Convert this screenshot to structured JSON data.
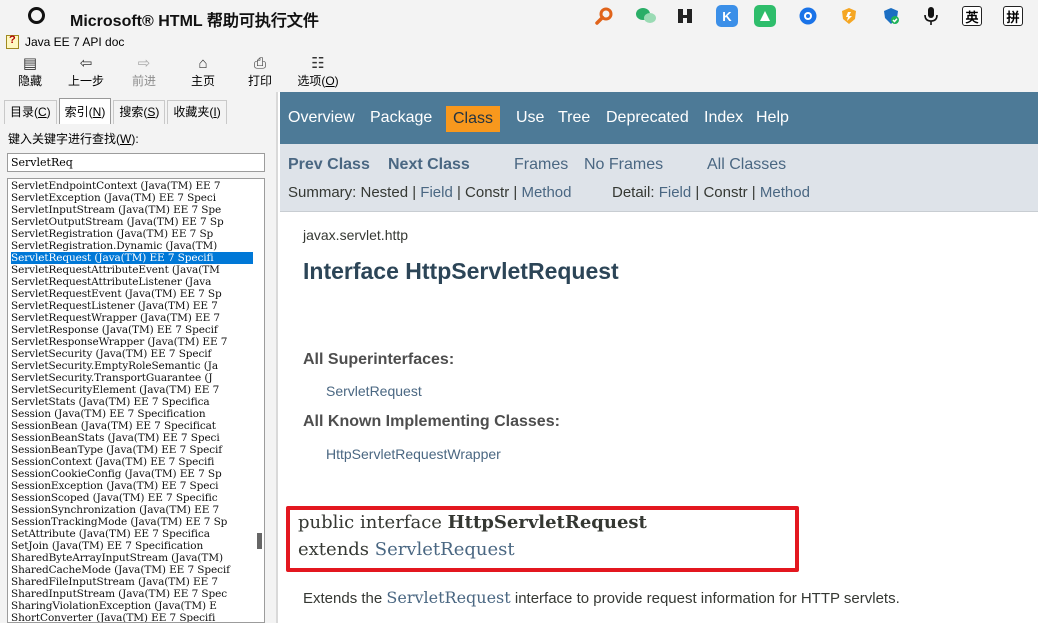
{
  "system_bar": {
    "title": "Microsoft® HTML 帮助可执行文件",
    "tray": {
      "ime_lang": "英",
      "ime_mode": "拼"
    }
  },
  "window": {
    "title": "Java EE 7 API doc"
  },
  "toolbar": {
    "hide_label": "隐藏",
    "back_label": "上一步",
    "forward_label": "前进",
    "home_label": "主页",
    "print_label": "打印",
    "options_label": "选项(",
    "options_key": "O",
    "options_tail": ")"
  },
  "nav": {
    "tabs": [
      {
        "label": "目录(",
        "key": "C",
        "tail": ")"
      },
      {
        "label": "索引(",
        "key": "N",
        "tail": ")"
      },
      {
        "label": "搜索(",
        "key": "S",
        "tail": ")"
      },
      {
        "label": "收藏夹(",
        "key": "I",
        "tail": ")"
      }
    ],
    "keyword_label": "键入关键字进行查找(",
    "keyword_key": "W",
    "keyword_tail": "):",
    "keyword_value": "ServletReq",
    "list_items": [
      "ServletEndpointContext (Java(TM) EE 7",
      "ServletException (Java(TM) EE 7 Speci",
      "ServletInputStream (Java(TM) EE 7 Spe",
      "ServletOutputStream (Java(TM) EE 7 Sp",
      "ServletRegistration (Java(TM) EE 7 Sp",
      "ServletRegistration.Dynamic (Java(TM)",
      "ServletRequest (Java(TM) EE 7 Specifi",
      "ServletRequestAttributeEvent (Java(TM",
      "ServletRequestAttributeListener (Java",
      "ServletRequestEvent (Java(TM) EE 7 Sp",
      "ServletRequestListener (Java(TM) EE 7",
      "ServletRequestWrapper (Java(TM) EE 7",
      "ServletResponse (Java(TM) EE 7 Specif",
      "ServletResponseWrapper (Java(TM) EE 7",
      "ServletSecurity (Java(TM) EE 7 Specif",
      "ServletSecurity.EmptyRoleSemantic (Ja",
      "ServletSecurity.TransportGuarantee (J",
      "ServletSecurityElement (Java(TM) EE 7",
      "ServletStats (Java(TM) EE 7 Specifica",
      "Session (Java(TM) EE 7 Specification",
      "SessionBean (Java(TM) EE 7 Specificat",
      "SessionBeanStats (Java(TM) EE 7 Speci",
      "SessionBeanType (Java(TM) EE 7 Specif",
      "SessionContext (Java(TM) EE 7 Specifi",
      "SessionCookieConfig (Java(TM) EE 7 Sp",
      "SessionException (Java(TM) EE 7 Speci",
      "SessionScoped (Java(TM) EE 7 Specific",
      "SessionSynchronization (Java(TM) EE 7",
      "SessionTrackingMode (Java(TM) EE 7 Sp",
      "SetAttribute (Java(TM) EE 7 Specifica",
      "SetJoin (Java(TM) EE 7 Specification",
      "SharedByteArrayInputStream (Java(TM)",
      "SharedCacheMode (Java(TM) EE 7 Specif",
      "SharedFileInputStream (Java(TM) EE 7",
      "SharedInputStream (Java(TM) EE 7 Spec",
      "SharingViolationException (Java(TM) E",
      "ShortConverter (Java(TM) EE 7 Specifi"
    ],
    "selected_index": 6
  },
  "content": {
    "topnav": [
      "Overview",
      "Package",
      "Class",
      "Use",
      "Tree",
      "Deprecated",
      "Index",
      "Help"
    ],
    "topnav_active": 2,
    "subnav": {
      "prev": "Prev Class",
      "next": "Next Class",
      "frames": "Frames",
      "no_frames": "No Frames",
      "all_classes": "All Classes",
      "summary_label": "Summary: Nested |",
      "summary_field": "Field",
      "summary_sep1": "| Constr |",
      "summary_method": "Method",
      "detail_label": "Detail:",
      "detail_field": "Field",
      "detail_sep": "| Constr |",
      "detail_method": "Method"
    },
    "package": "javax.servlet.http",
    "title": "Interface HttpServletRequest",
    "superinterfaces_heading": "All Superinterfaces:",
    "superinterface": "ServletRequest",
    "implementing_heading": "All Known Implementing Classes:",
    "implementing_class": "HttpServletRequestWrapper",
    "signature": {
      "prefix": "public interface ",
      "name": "HttpServletRequest",
      "extends_kw": "extends ",
      "extends_name": "ServletRequest"
    },
    "description": {
      "before": "Extends the ",
      "code": "ServletRequest",
      "after": " interface to provide request information for HTTP servlets."
    }
  }
}
